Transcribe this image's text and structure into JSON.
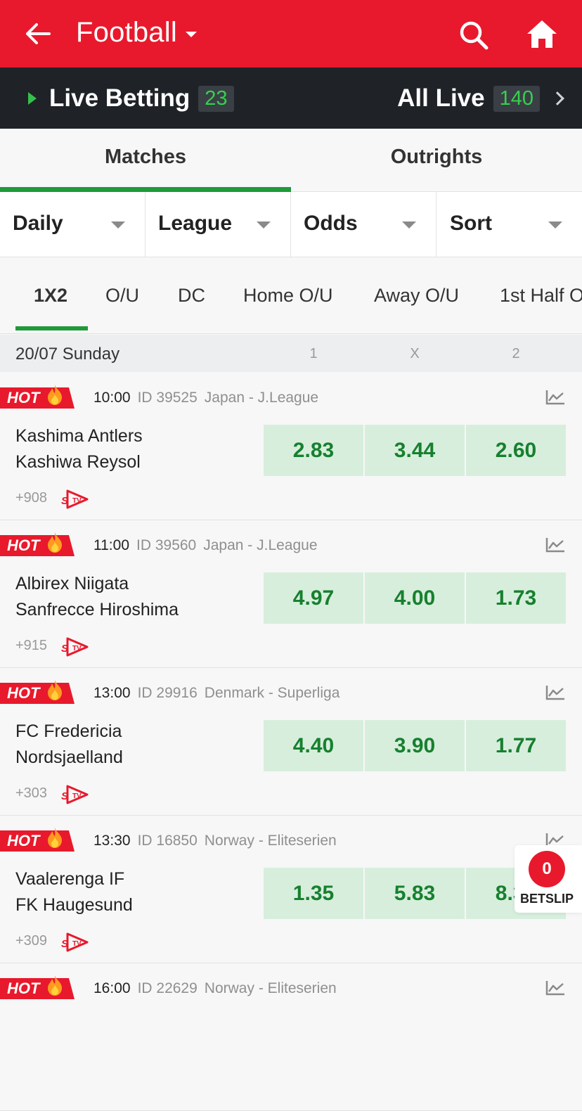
{
  "header": {
    "title": "Football",
    "back_icon": "back-arrow-icon",
    "search_icon": "search-icon",
    "home_icon": "home-icon",
    "color": "#e8192c"
  },
  "live_bar": {
    "live_label": "Live Betting",
    "live_count": "23",
    "all_label": "All Live",
    "all_count": "140"
  },
  "tabs": [
    {
      "label": "Matches",
      "active": true
    },
    {
      "label": "Outrights",
      "active": false
    }
  ],
  "filters": [
    "Daily",
    "League",
    "Odds",
    "Sort"
  ],
  "markets": [
    {
      "label": "1X2",
      "active": true
    },
    {
      "label": "O/U"
    },
    {
      "label": "DC"
    },
    {
      "label": "Home O/U"
    },
    {
      "label": "Away O/U"
    },
    {
      "label": "1st Half O"
    }
  ],
  "date_header": {
    "date": "20/07 Sunday",
    "cols": [
      "1",
      "X",
      "2"
    ]
  },
  "matches": [
    {
      "hot": "HOT",
      "time": "10:00",
      "id": "ID 39525",
      "league": "Japan - J.League",
      "home": "Kashima Antlers",
      "away": "Kashiwa Reysol",
      "odds": [
        "2.83",
        "3.44",
        "2.60"
      ],
      "more": "+908"
    },
    {
      "hot": "HOT",
      "time": "11:00",
      "id": "ID 39560",
      "league": "Japan - J.League",
      "home": "Albirex Niigata",
      "away": "Sanfrecce Hiroshima",
      "odds": [
        "4.97",
        "4.00",
        "1.73"
      ],
      "more": "+915"
    },
    {
      "hot": "HOT",
      "time": "13:00",
      "id": "ID 29916",
      "league": "Denmark - Superliga",
      "home": "FC Fredericia",
      "away": "Nordsjaelland",
      "odds": [
        "4.40",
        "3.90",
        "1.77"
      ],
      "more": "+303"
    },
    {
      "hot": "HOT",
      "time": "13:30",
      "id": "ID 16850",
      "league": "Norway - Eliteserien",
      "home": "Vaalerenga IF",
      "away": "FK Haugesund",
      "odds": [
        "1.35",
        "5.83",
        "8.31"
      ],
      "more": "+309"
    },
    {
      "hot": "HOT",
      "time": "16:00",
      "id": "ID 22629",
      "league": "Norway - Eliteserien",
      "home": "",
      "away": "",
      "odds": [],
      "more": ""
    }
  ],
  "betslip": {
    "count": "0",
    "label": "BETSLIP"
  }
}
